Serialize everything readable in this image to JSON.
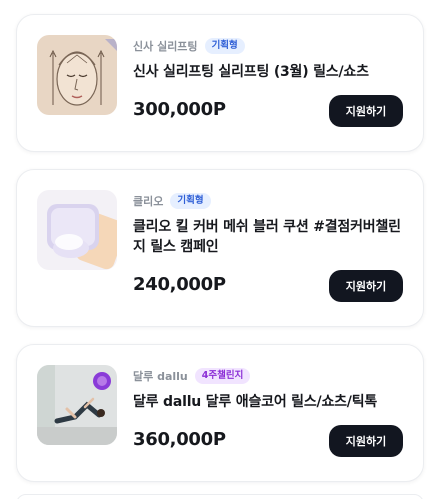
{
  "campaigns": [
    {
      "brand": "신사 실리프팅",
      "badge": "기획형",
      "title": "신사 실리프팅 실리프팅 (3월) 릴스/쇼츠",
      "price": "300,000P",
      "apply_label": "지원하기",
      "thumb_icon": "face-lifting-illustration-icon"
    },
    {
      "brand": "클리오",
      "badge": "기획형",
      "title": "클리오 킬 커버 메쉬 블러 쿠션 #결점커버챌린지 릴스 캠페인",
      "price": "240,000P",
      "apply_label": "지원하기",
      "thumb_icon": "cushion-compact-icon"
    },
    {
      "brand": "달루 dallu",
      "badge": "4주챌린지",
      "title": "달루 dallu 달루 애슬코어 릴스/쇼츠/틱톡",
      "price": "360,000P",
      "apply_label": "지원하기",
      "thumb_icon": "pilates-woman-icon"
    }
  ],
  "colors": {
    "badge_blue_bg": "#e6efff",
    "badge_blue_text": "#2f5fd6",
    "badge_purple_bg": "#f1e4ff",
    "badge_purple_text": "#8c2fd6",
    "button_bg": "#121620"
  }
}
